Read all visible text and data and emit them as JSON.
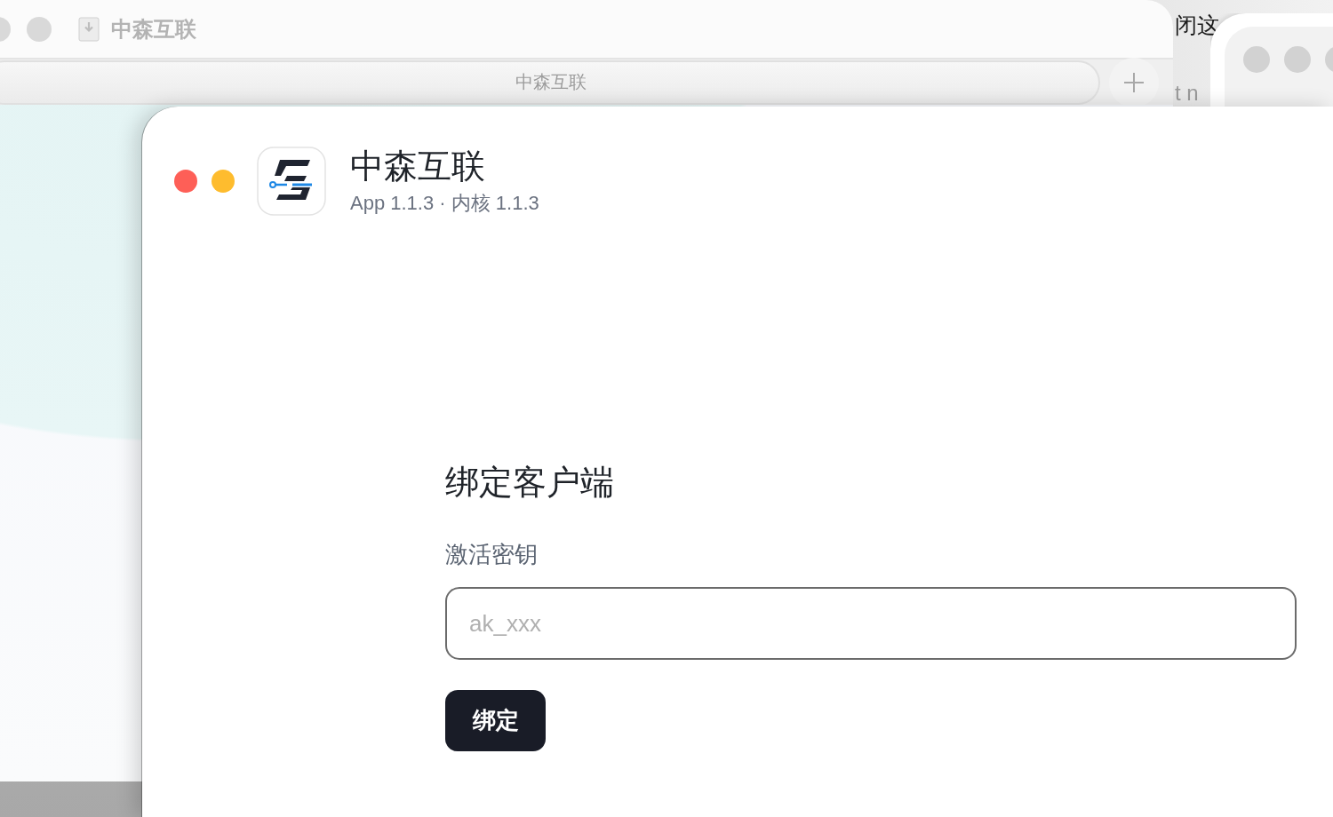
{
  "back_window": {
    "title": "中森互联",
    "address_bar": {
      "text": "中森互联"
    }
  },
  "side_window": {
    "texts": [
      "闭这",
      "t n"
    ]
  },
  "main_window": {
    "app": {
      "name": "中森互联",
      "version": "App 1.1.3 · 内核 1.1.3"
    },
    "bind_form": {
      "heading": "绑定客户端",
      "key_field": {
        "label": "激活密钥",
        "placeholder": "ak_xxx"
      },
      "submit_button": "绑定"
    }
  }
}
